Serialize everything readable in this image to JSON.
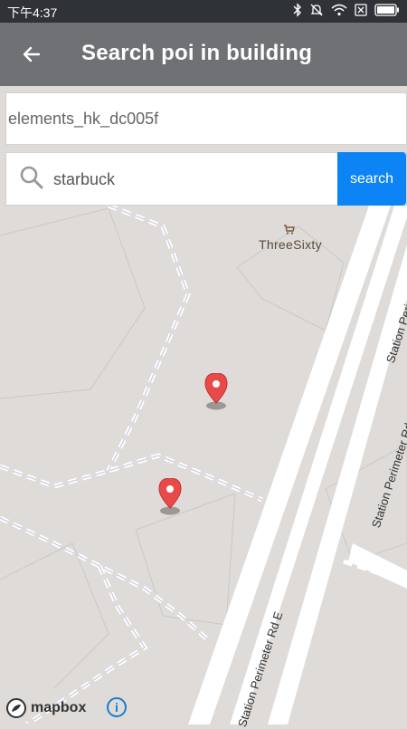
{
  "status_bar": {
    "time": "下午4:37",
    "icons": [
      "bluetooth-icon",
      "mute-bell-icon",
      "wifi-icon",
      "sim-x-icon",
      "battery-icon"
    ]
  },
  "app_bar": {
    "title": "Search poi in building",
    "back_icon": "arrow-left-icon"
  },
  "building_field": {
    "value": "elements_hk_dc005f"
  },
  "search": {
    "value": "starbuck",
    "button_label": "search",
    "icon": "search-icon"
  },
  "map": {
    "poi_label": "ThreeSixty",
    "poi_icon": "shopping-cart-icon",
    "road_labels": [
      "Station Perimeter Rd E",
      "Station Perimeter Rd E",
      "Station Perime"
    ],
    "marker_color": "#e84a4a",
    "attribution": "mapbox",
    "info_icon": "info-icon"
  }
}
